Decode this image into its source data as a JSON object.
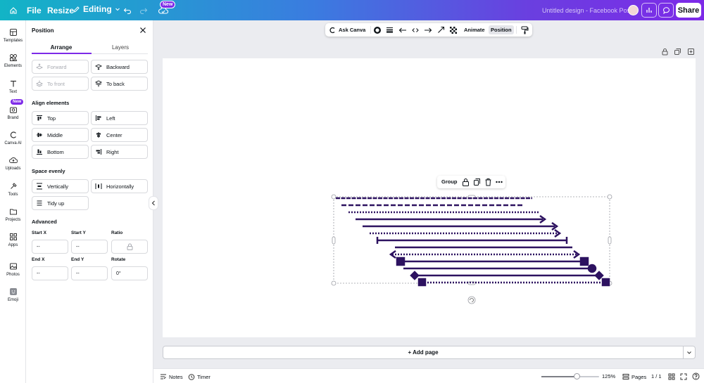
{
  "topbar": {
    "file_label": "File",
    "resize_label": "Resize",
    "editing_label": "Editing",
    "new_badge": "New",
    "design_title": "Untitled design - Facebook Post",
    "share_label": "Share"
  },
  "rail": {
    "items": [
      {
        "label": "Templates",
        "icon": "templates-icon"
      },
      {
        "label": "Elements",
        "icon": "elements-icon"
      },
      {
        "label": "Text",
        "icon": "text-icon"
      },
      {
        "label": "Brand",
        "icon": "brand-icon"
      },
      {
        "label": "Canva AI",
        "icon": "canva-ai-icon"
      },
      {
        "label": "Uploads",
        "icon": "uploads-icon"
      },
      {
        "label": "Tools",
        "icon": "tools-icon"
      },
      {
        "label": "Projects",
        "icon": "projects-icon"
      },
      {
        "label": "Apps",
        "icon": "apps-icon"
      },
      {
        "label": "Photos",
        "icon": "photos-icon"
      },
      {
        "label": "Emoji",
        "icon": "emoji-icon"
      }
    ],
    "brand_new_badge": "New"
  },
  "panel": {
    "title": "Position",
    "tabs": {
      "arrange": "Arrange",
      "layers": "Layers"
    },
    "order": {
      "forward": "Forward",
      "backward": "Backward",
      "to_front": "To front",
      "to_back": "To back"
    },
    "align_title": "Align elements",
    "align": {
      "top": "Top",
      "left": "Left",
      "middle": "Middle",
      "center": "Center",
      "bottom": "Bottom",
      "right": "Right"
    },
    "space_title": "Space evenly",
    "space": {
      "vertically": "Vertically",
      "horizontally": "Horizontally",
      "tidy": "Tidy up"
    },
    "advanced_title": "Advanced",
    "fields": {
      "start_x_label": "Start X",
      "start_x_value": "--",
      "start_y_label": "Start Y",
      "start_y_value": "--",
      "ratio_label": "Ratio",
      "end_x_label": "End X",
      "end_x_value": "--",
      "end_y_label": "End Y",
      "end_y_value": "--",
      "rotate_label": "Rotate",
      "rotate_value": "0°"
    }
  },
  "toolbar": {
    "ask_canva": "Ask Canva",
    "animate": "Animate",
    "position": "Position"
  },
  "selection": {
    "group_label": "Group"
  },
  "add_page": "+ Add page",
  "bottombar": {
    "notes": "Notes",
    "timer": "Timer",
    "zoom": "125%",
    "zoom_level": 0.62,
    "pages": "Pages",
    "page_count": "1 / 1"
  },
  "colors": {
    "accent": "#7d2ae8",
    "line": "#3a1473"
  }
}
